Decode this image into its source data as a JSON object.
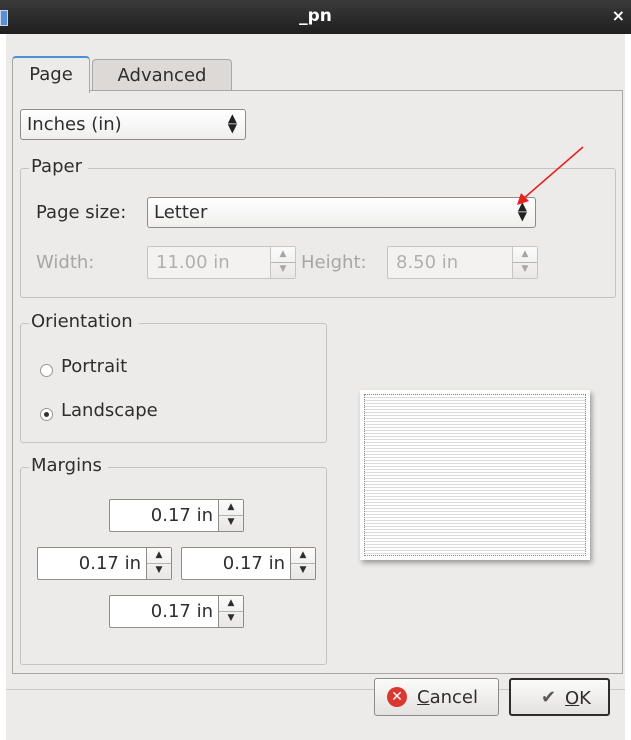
{
  "window": {
    "title": "_pn",
    "close_glyph": "×"
  },
  "tabs": [
    {
      "label": "Page",
      "active": true
    },
    {
      "label": "Advanced",
      "active": false
    }
  ],
  "units_select": {
    "value": "Inches (in)"
  },
  "paper": {
    "legend": "Paper",
    "page_size_label": "Page size:",
    "page_size_value": "Letter",
    "width_label": "Width:",
    "width_value": "11.00 in",
    "height_label": "Height:",
    "height_value": "8.50 in"
  },
  "orientation": {
    "legend": "Orientation",
    "options": [
      {
        "label": "Portrait",
        "checked": false
      },
      {
        "label": "Landscape",
        "checked": true
      }
    ]
  },
  "margins": {
    "legend": "Margins",
    "top": "0.17 in",
    "left": "0.17 in",
    "right": "0.17 in",
    "bottom": "0.17 in"
  },
  "buttons": {
    "cancel": {
      "label": "Cancel",
      "mnemonic": "C",
      "rest": "ancel"
    },
    "ok": {
      "label": "OK",
      "mnemonic": "O",
      "rest": "K"
    }
  },
  "colors": {
    "annotation_arrow": "#e8201c",
    "tab_highlight": "#4f8ed2"
  }
}
